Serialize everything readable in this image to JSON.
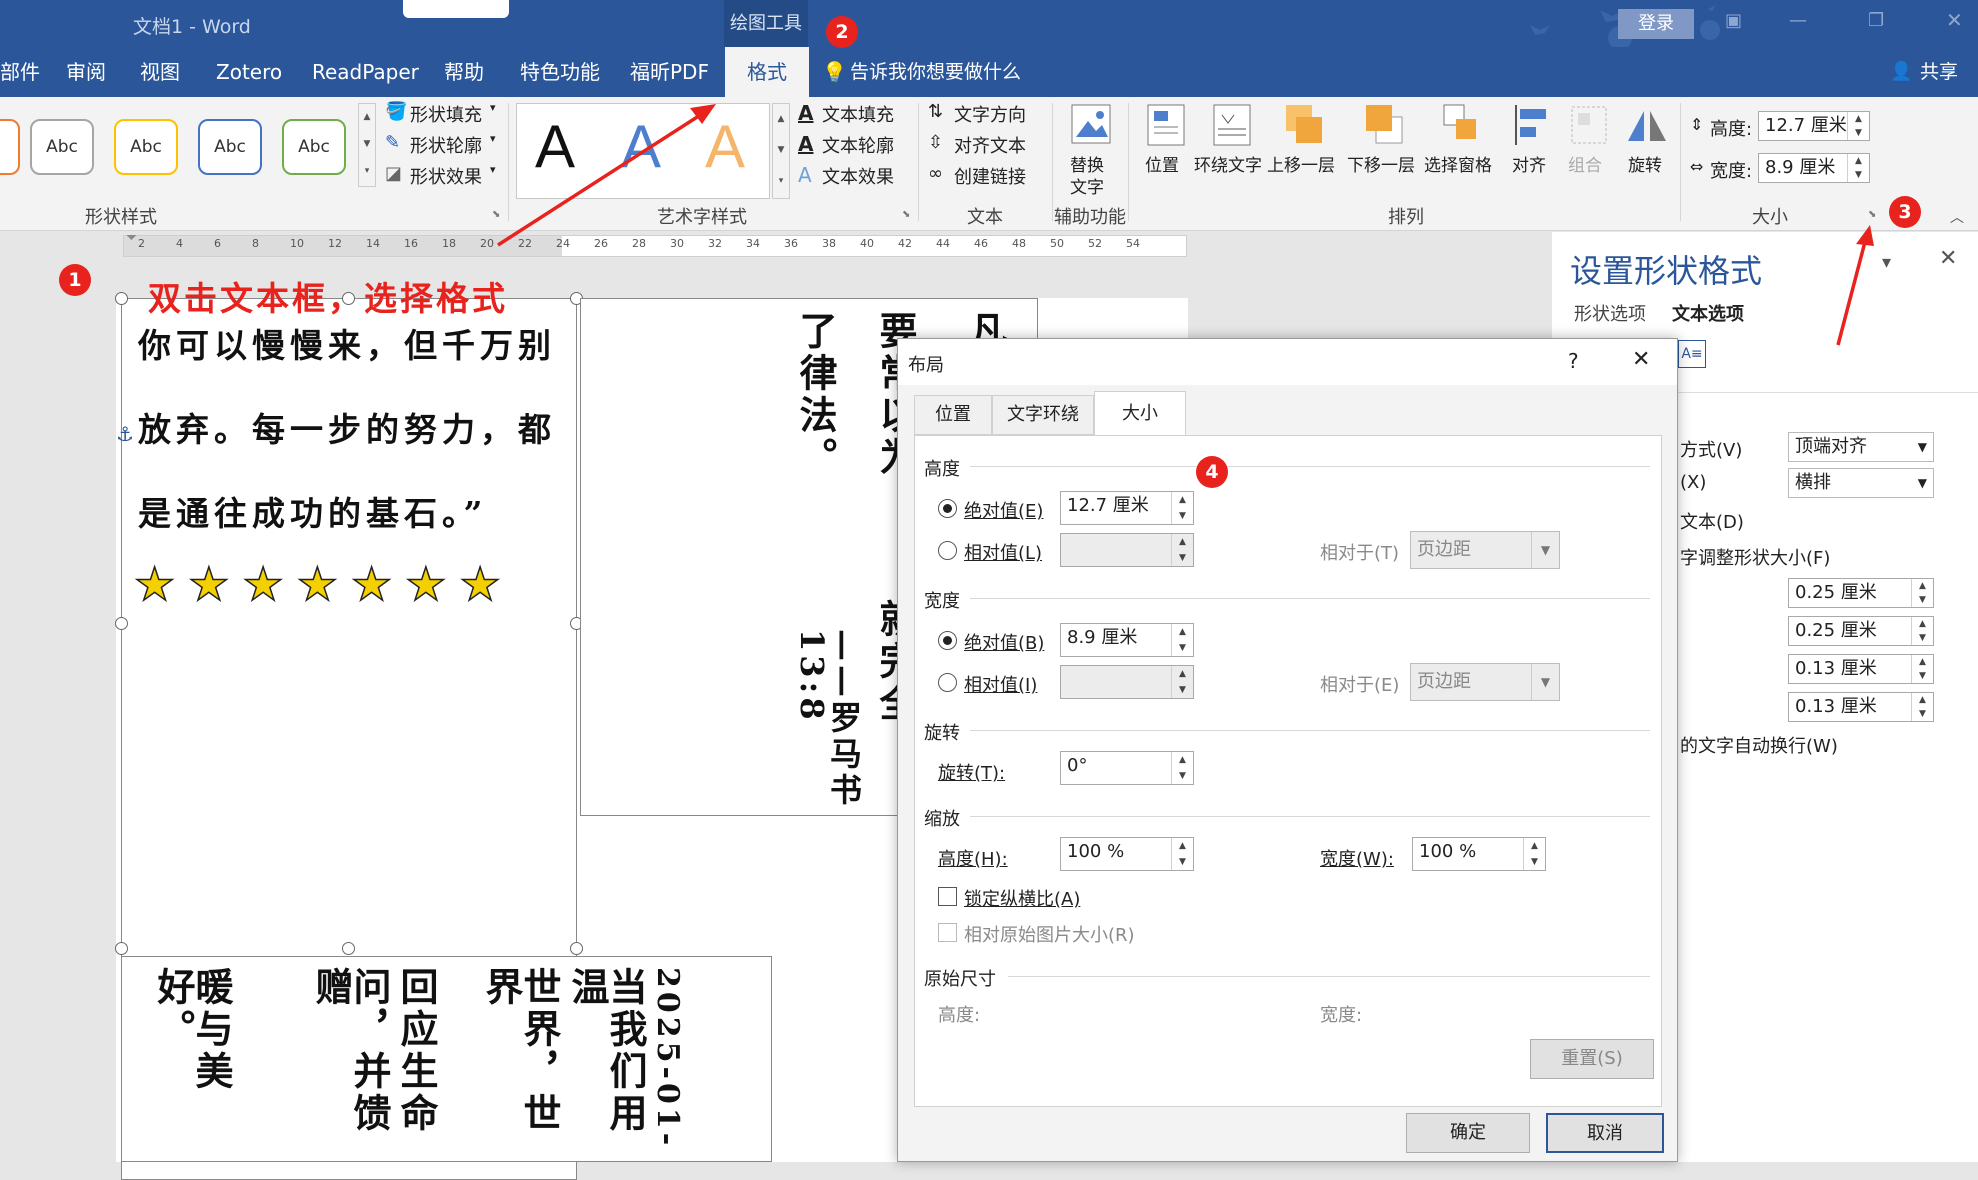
{
  "titlebar": {
    "doc_title": "文档1 - Word",
    "context_title": "绘图工具",
    "login": "登录"
  },
  "tabs": [
    "部件",
    "审阅",
    "视图",
    "Zotero",
    "ReadPaper",
    "帮助",
    "特色功能",
    "福昕PDF",
    "格式"
  ],
  "tell_me": "告诉我你想要做什么",
  "share": "共享",
  "ribbon": {
    "shape_style_buttons": [
      "Abc",
      "Abc",
      "Abc",
      "Abc"
    ],
    "shape_fill": "形状填充",
    "shape_outline": "形状轮廓",
    "shape_effect": "形状效果",
    "group_shape_styles": "形状样式",
    "wordart_sample": "A",
    "text_fill": "文本填充",
    "text_outline": "文本轮廓",
    "text_effect": "文本效果",
    "group_wordart": "艺术字样式",
    "text_direction": "文字方向",
    "align_text": "对齐文本",
    "create_link": "创建链接",
    "group_text": "文本",
    "alt_text_line1": "替换",
    "alt_text_line2": "文字",
    "group_accessibility": "辅助功能",
    "position": "位置",
    "wrap_text": "环绕文字",
    "bring_forward": "上移一层",
    "send_backward": "下移一层",
    "selection_pane": "选择窗格",
    "align": "对齐",
    "group": "组合",
    "rotate": "旋转",
    "group_arrange": "排列",
    "height_label": "高度:",
    "height_value": "12.7 厘米",
    "width_label": "宽度:",
    "width_value": "8.9 厘米",
    "group_size": "大小"
  },
  "annotations": {
    "instruction": "双击文本框，选择格式",
    "n1": "1",
    "n2": "2",
    "n3": "3",
    "n4": "4"
  },
  "ruler": {
    "labels": [
      "2",
      "4",
      "6",
      "8",
      "10",
      "12",
      "14",
      "16",
      "18",
      "20",
      "22",
      "24",
      "26",
      "28",
      "30",
      "32",
      "34",
      "36",
      "38",
      "40",
      "42",
      "44",
      "46",
      "48",
      "50",
      "52",
      "54"
    ]
  },
  "document": {
    "tb1_lines": [
      "你可以慢慢来，但千万别",
      "放弃。每一步的努力，都",
      "是通往成功的基石。”"
    ],
    "stars": [
      "★",
      "★",
      "★",
      "★",
      "★",
      "★",
      "★"
    ],
    "tb2_cols": [
      "凡",
      "要",
      "了",
      "律",
      "法。"
    ],
    "tb2_col1": "要常以为",
    "tb2_col2": "凡",
    "tb2_col3": "了律法。",
    "tb2_col4": "因为爱人的就完全",
    "tb2_ref": "——罗马书 13:8",
    "tb3_cols": [
      "暖与美好。",
      "问，并馈赠",
      "回应生命",
      "世界，世界",
      "当我们用温"
    ],
    "tb3_date": "2025-01-"
  },
  "pane": {
    "title": "设置形状格式",
    "tab1": "形状选项",
    "tab2": "文本选项",
    "vertical_align_label": "方式(V)",
    "vertical_align_value": "顶端对齐",
    "direction_label": "(X)",
    "direction_value": "横排",
    "rotate_label": "文本(D)",
    "resize_label": "字调整形状大小(F)",
    "margins": [
      "0.25 厘米",
      "0.25 厘米",
      "0.13 厘米",
      "0.13 厘米"
    ],
    "wrap_label": "的文字自动换行(W)"
  },
  "dialog": {
    "title": "布局",
    "help": "?",
    "tabs": [
      "位置",
      "文字环绕",
      "大小"
    ],
    "height_section": "高度",
    "abs_h": "绝对值(E)",
    "abs_h_value": "12.7 厘米",
    "rel_h": "相对值(L)",
    "rel_to_t": "相对于(T)",
    "rel_to_t_value": "页边距",
    "width_section": "宽度",
    "abs_w": "绝对值(B)",
    "abs_w_value": "8.9 厘米",
    "rel_w": "相对值(I)",
    "rel_to_e": "相对于(E)",
    "rel_to_e_value": "页边距",
    "rotate_section": "旋转",
    "rotate_label": "旋转(T):",
    "rotate_value": "0°",
    "scale_section": "缩放",
    "scale_h": "高度(H):",
    "scale_h_value": "100 %",
    "scale_w": "宽度(W):",
    "scale_w_value": "100 %",
    "lock_ratio": "锁定纵横比(A)",
    "relative_original": "相对原始图片大小(R)",
    "original_section": "原始尺寸",
    "orig_h": "高度:",
    "orig_w": "宽度:",
    "reset": "重置(S)",
    "ok": "确定",
    "cancel": "取消"
  },
  "colors": {
    "word_blue": "#2b579a",
    "accent_red": "#e8231d",
    "star": "#f5d000"
  }
}
